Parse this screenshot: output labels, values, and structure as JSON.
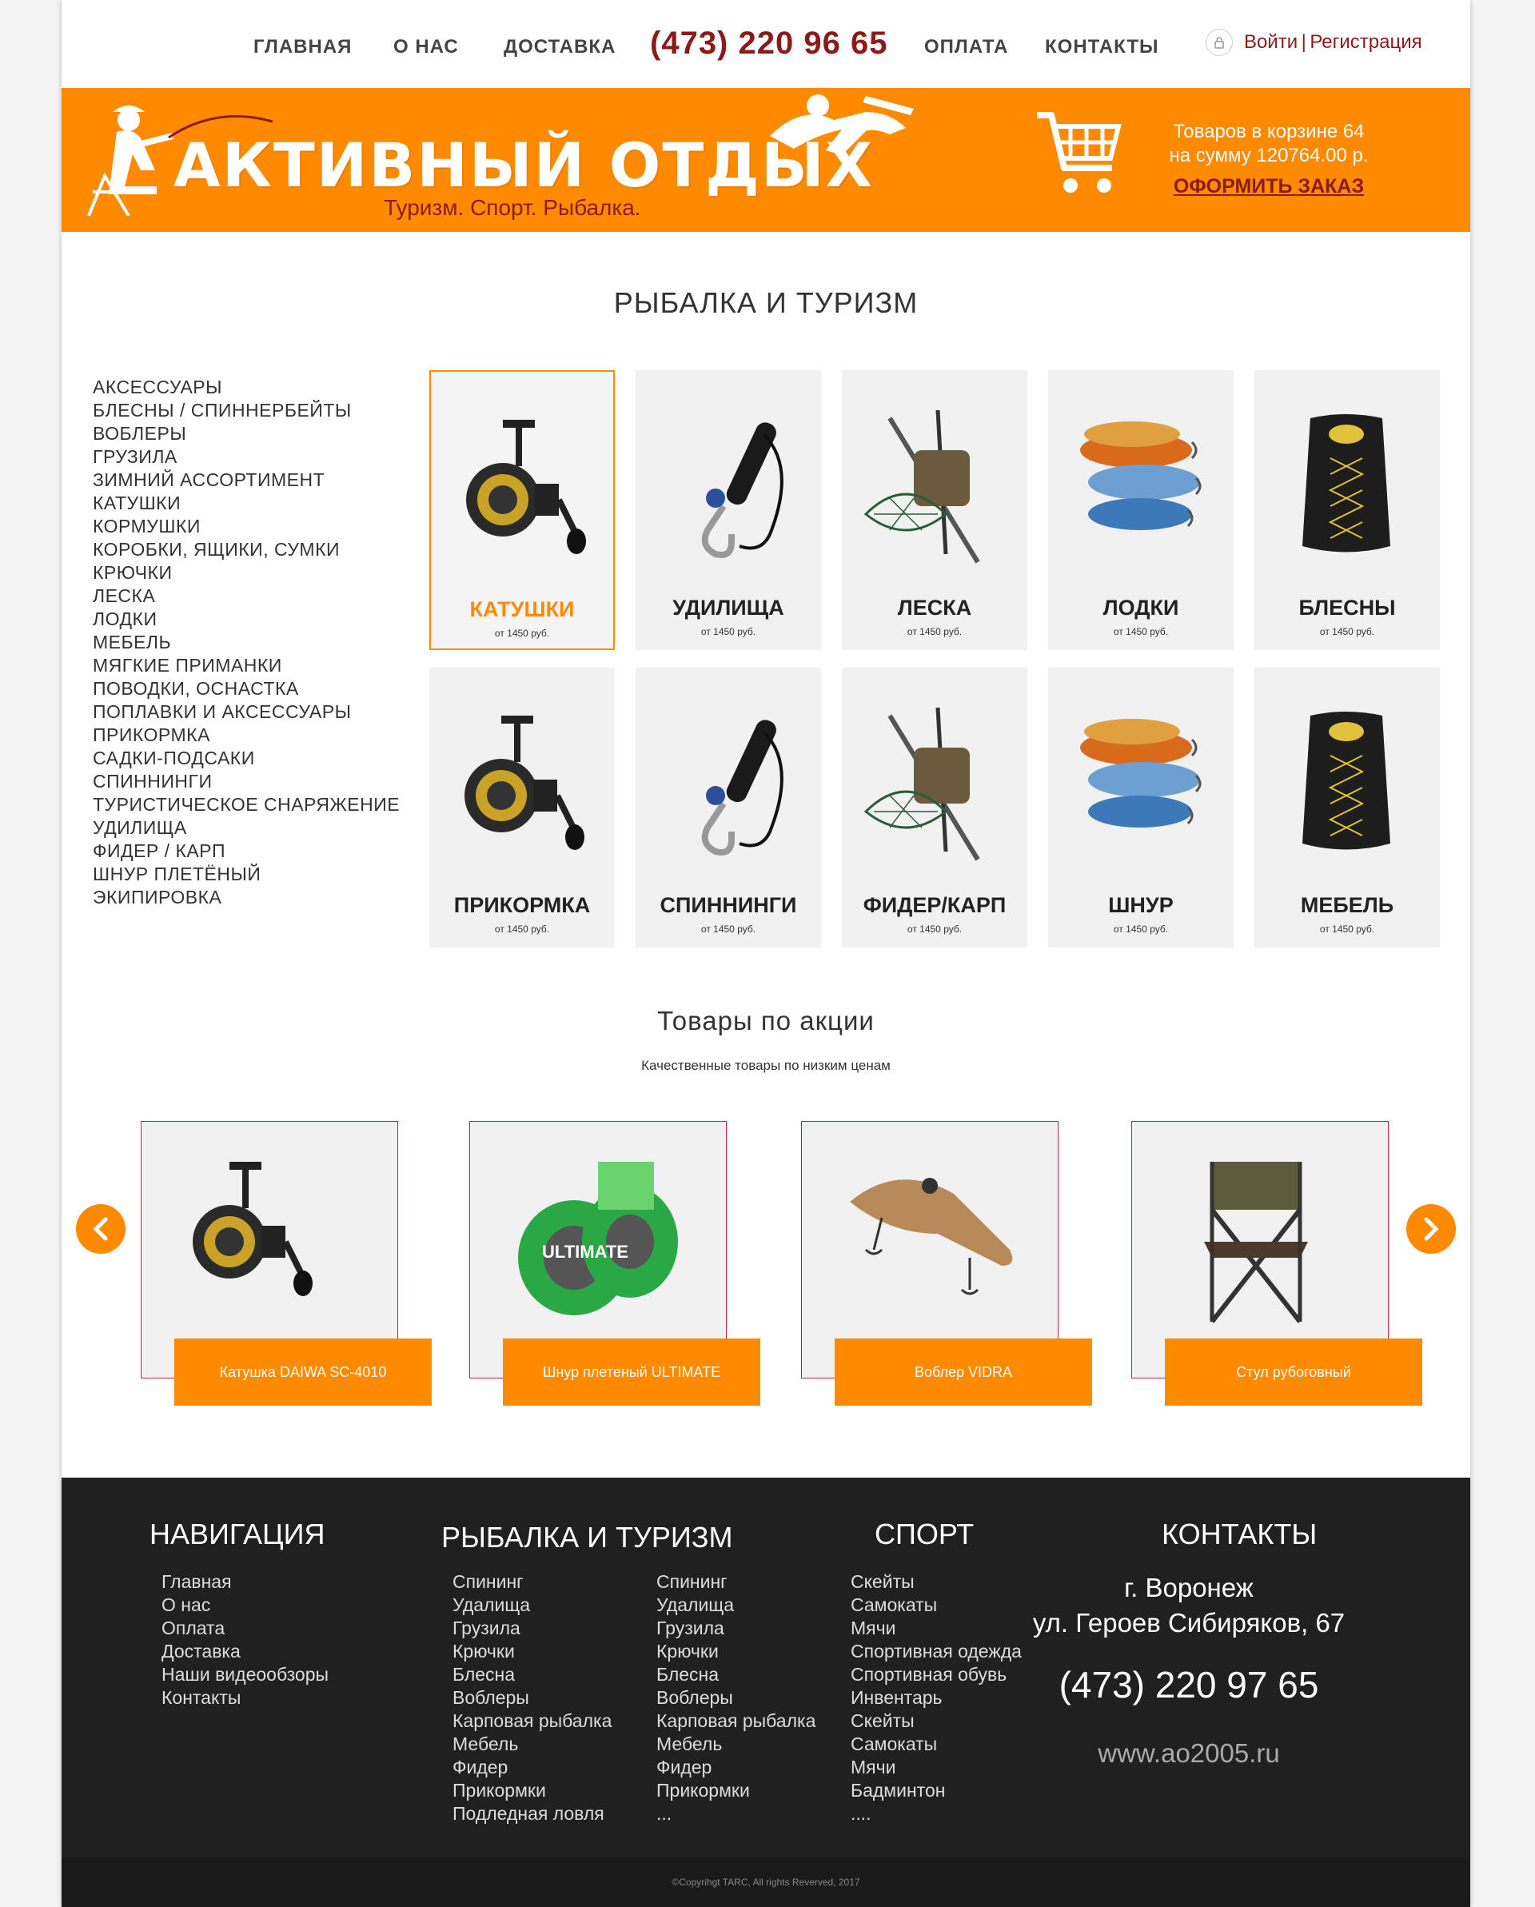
{
  "nav": {
    "home": "ГЛАВНАЯ",
    "about": "О НАС",
    "delivery": "ДОСТАВКА",
    "phone": "(473) 220 96 65",
    "payment": "ОПЛАТА",
    "contacts": "КОНТАКТЫ",
    "login": "Войти",
    "separator": "|",
    "register": "Регистрация"
  },
  "banner": {
    "brand": "АКТИВНЫЙ ОТДЫХ",
    "slogan": "Туризм. Спорт. Рыбалка.",
    "cart_count": "Товаров в корзине 64",
    "cart_sum": "на сумму  120764.00 р.",
    "checkout": "ОФОРМИТЬ ЗАКАЗ"
  },
  "catalog": {
    "title": "РЫБАЛКА И ТУРИЗМ",
    "sidebar": [
      "АКСЕССУАРЫ",
      "БЛЕСНЫ / СПИННЕРБЕЙТЫ",
      "ВОБЛЕРЫ",
      "ГРУЗИЛА",
      "ЗИМНИЙ АССОРТИМЕНТ",
      "КАТУШКИ",
      "КОРМУШКИ",
      "КОРОБКИ, ЯЩИКИ, СУМКИ",
      "КРЮЧКИ",
      "ЛЕСКА",
      "ЛОДКИ",
      "МЕБЕЛЬ",
      "МЯГКИЕ ПРИМАНКИ",
      "ПОВОДКИ, ОСНАСТКА",
      "ПОПЛАВКИ И АКСЕССУАРЫ",
      "ПРИКОРМКА",
      "САДКИ-ПОДСАКИ",
      "СПИННИНГИ",
      "ТУРИСТИЧЕСКОЕ СНАРЯЖЕНИЕ",
      "УДИЛИЩА",
      "ФИДЕР / КАРП",
      "ШНУР ПЛЕТЁНЫЙ",
      "ЭКИПИРОВКА"
    ],
    "tiles": [
      {
        "name": "КАТУШКИ",
        "price": "от 1450 руб.",
        "icon": "reel-icon"
      },
      {
        "name": "УДИЛИЩА",
        "price": "от 1450 руб.",
        "icon": "lip-grip-icon"
      },
      {
        "name": "ЛЕСКА",
        "price": "от 1450 руб.",
        "icon": "landing-net-icon"
      },
      {
        "name": "ЛОДКИ",
        "price": "от 1450 руб.",
        "icon": "wobblers-icon"
      },
      {
        "name": "БЛЕСНЫ",
        "price": "от 1450 руб.",
        "icon": "backpack-icon"
      },
      {
        "name": "ПРИКОРМКА",
        "price": "от 1450 руб.",
        "icon": "reel-icon"
      },
      {
        "name": "СПИННИНГИ",
        "price": "от 1450 руб.",
        "icon": "lip-grip-icon"
      },
      {
        "name": "ФИДЕР/КАРП",
        "price": "от 1450 руб.",
        "icon": "landing-net-icon"
      },
      {
        "name": "ШНУР",
        "price": "от 1450 руб.",
        "icon": "wobblers-icon"
      },
      {
        "name": "МЕБЕЛЬ",
        "price": "от 1450 руб.",
        "icon": "backpack-icon"
      }
    ]
  },
  "promo": {
    "title": "Товары по акции",
    "subtitle": "Качественные товары по низким ценам",
    "items": [
      {
        "label": "Катушка DAIWA SC-4010",
        "icon": "reel-icon"
      },
      {
        "label": "Шнур плетеный ULTIMATE",
        "icon": "braid-spool-icon"
      },
      {
        "label": "Воблер VIDRA",
        "icon": "wobbler-icon"
      },
      {
        "label": "Стул рубоговный",
        "icon": "folding-chair-icon"
      }
    ]
  },
  "footer": {
    "nav_title": "НАВИГАЦИЯ",
    "nav_items": [
      "Главная",
      "О нас",
      "Оплата",
      "Доставка",
      "Наши видеообзоры",
      "Контакты"
    ],
    "fish_title": "РЫБАЛКА И ТУРИЗМ",
    "fish_col1": [
      "Спининг",
      "Удалища",
      "Грузила",
      "Крючки",
      "Блесна",
      "Воблеры",
      "Карповая рыбалка",
      "Мебель",
      "Фидер",
      "Прикормки",
      "Подледная ловля"
    ],
    "fish_col2": [
      "Спининг",
      "Удалища",
      "Грузила",
      "Крючки",
      "Блесна",
      "Воблеры",
      "Карповая рыбалка",
      "Мебель",
      "Фидер",
      "Прикормки",
      "..."
    ],
    "sport_title": "СПОРТ",
    "sport_items": [
      "Скейты",
      "Самокаты",
      "Мячи",
      "Спортивная одежда",
      "Спортивная обувь",
      "Инвентарь",
      "Скейты",
      "Самокаты",
      "Мячи",
      "Бадминтон",
      "...."
    ],
    "contacts_title": "КОНТАКТЫ",
    "city": "г. Воронеж",
    "address": "ул. Героев Сибиряков, 67",
    "phone": "(473) 220 97 65",
    "site": "www.ao2005.ru",
    "copyright": "©Copyrihgt TARC, All rights Reverved, 2017"
  },
  "colors": {
    "accent": "#ff8a00",
    "brand_dark": "#8b1a1a",
    "footer": "#202020"
  }
}
